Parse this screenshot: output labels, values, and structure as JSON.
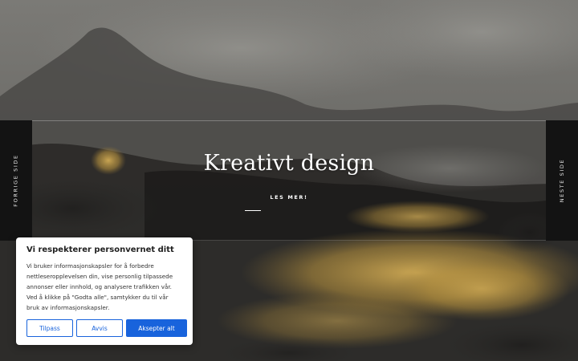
{
  "hero": {
    "title": "Kreativt design",
    "read_more": "LES MER!"
  },
  "slider": {
    "prev_label": "FORRIGE SIDE",
    "next_label": "NESTE SIDE"
  },
  "cookie_banner": {
    "title": "Vi respekterer personvernet ditt",
    "description": "Vi bruker informasjonskapsler for å forbedre nettleseropplevelsen din, vise personlig tilpassede annonser eller innhold, og analysere trafikken vår. Ved å klikke på \"Godta alle\", samtykker du til vår bruk av informasjonskapsler.",
    "customize_label": "Tilpass",
    "reject_label": "Avvis",
    "accept_label": "Aksepter alt",
    "accent_color": "#1863dc"
  },
  "colors": {
    "nav_background": "#131313",
    "gold": "#c9a24a"
  }
}
